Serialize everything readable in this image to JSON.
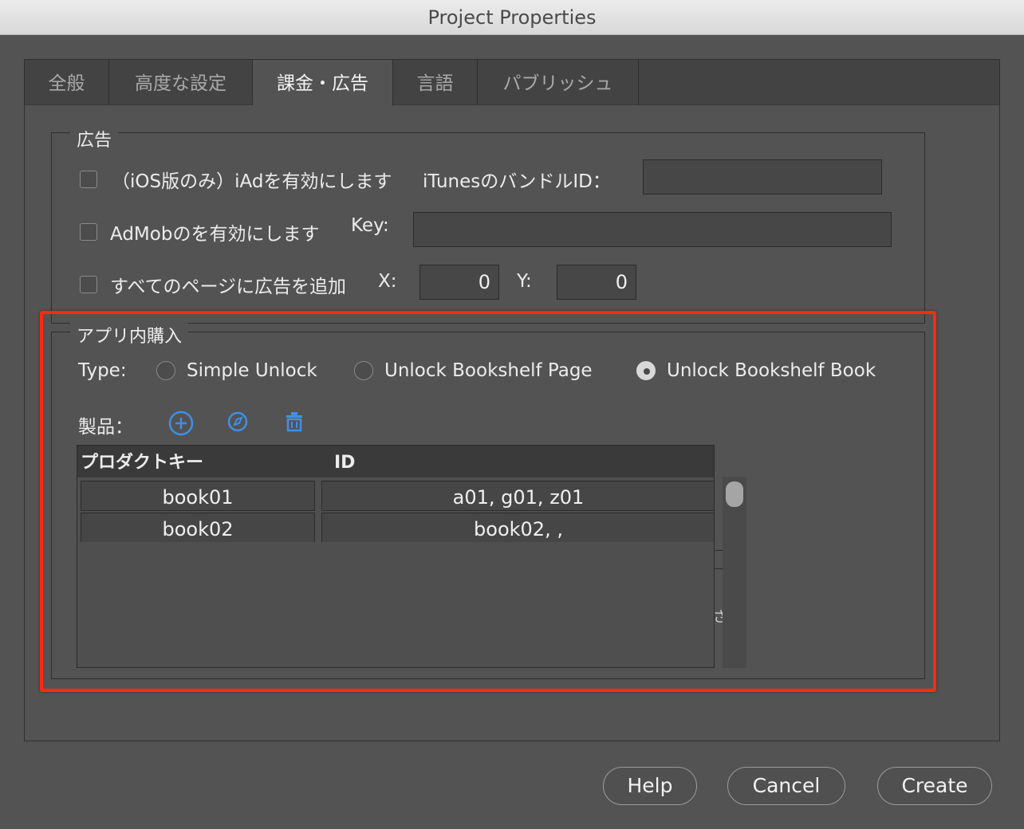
{
  "window": {
    "title": "Project Properties"
  },
  "tabs": [
    {
      "label": "全般"
    },
    {
      "label": "高度な設定"
    },
    {
      "label": "課金・広告"
    },
    {
      "label": "言語"
    },
    {
      "label": "パブリッシュ"
    }
  ],
  "ads": {
    "legend": "広告",
    "iad_label": "（iOS版のみ）iAdを有効にします",
    "itunes_label": "iTunesのバンドルID：",
    "itunes_value": "",
    "admob_label": "AdMobのを有効にします",
    "key_label": "Key:",
    "key_value": "",
    "allpages_label": "すべてのページに広告を追加",
    "x_label": "X:",
    "x_value": "0",
    "y_label": "Y:",
    "y_value": "0"
  },
  "iap": {
    "legend": "アプリ内購入",
    "type_label": "Type:",
    "options": [
      {
        "label": "Simple Unlock",
        "selected": false
      },
      {
        "label": "Unlock Bookshelf Page",
        "selected": false
      },
      {
        "label": "Unlock Bookshelf Book",
        "selected": true
      }
    ],
    "products_label": "製品：",
    "icons": [
      "add-circle-icon",
      "compass-edit-icon",
      "trash-icon"
    ],
    "columns": [
      "プロダクトキー",
      "ID"
    ],
    "rows": [
      {
        "key": "book01",
        "id": "a01, g01, z01"
      },
      {
        "key": "book02",
        "id": "book02, ,"
      }
    ],
    "clipped_glyph": "さ"
  },
  "footer": {
    "help": "Help",
    "cancel": "Cancel",
    "create": "Create"
  },
  "colors": {
    "accent_icon": "#3f8fe8",
    "highlight": "#ff2a12",
    "background": "#535353"
  }
}
